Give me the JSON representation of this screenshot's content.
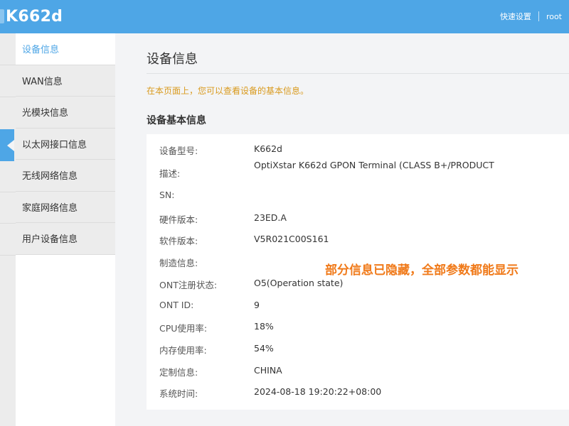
{
  "header": {
    "title": "K662d",
    "quick_setup": "快速设置",
    "user": "root"
  },
  "sidebar": {
    "items": [
      {
        "label": "设备信息",
        "active": true
      },
      {
        "label": "WAN信息",
        "active": false
      },
      {
        "label": "光模块信息",
        "active": false
      },
      {
        "label": "以太网接口信息",
        "active": false
      },
      {
        "label": "无线网络信息",
        "active": false
      },
      {
        "label": "家庭网络信息",
        "active": false
      },
      {
        "label": "用户设备信息",
        "active": false
      }
    ]
  },
  "main": {
    "page_title": "设备信息",
    "hint": "在本页面上，您可以查看设备的基本信息。",
    "section_title": "设备基本信息",
    "overlay_note": "部分信息已隐藏，全部参数都能显示",
    "fields": [
      {
        "label": "设备型号:",
        "value": "K662d"
      },
      {
        "label": "描述:",
        "value": "OptiXstar K662d GPON Terminal (CLASS B+/PRODUCT"
      },
      {
        "label": "SN:",
        "value": ""
      },
      {
        "label": "硬件版本:",
        "value": "23ED.A"
      },
      {
        "label": "软件版本:",
        "value": "V5R021C00S161"
      },
      {
        "label": "制造信息:",
        "value": ""
      },
      {
        "label": "ONT注册状态:",
        "value": "O5(Operation state)"
      },
      {
        "label": "ONT ID:",
        "value": "9"
      },
      {
        "label": "CPU使用率:",
        "value": "18%"
      },
      {
        "label": "内存使用率:",
        "value": "54%"
      },
      {
        "label": "定制信息:",
        "value": "CHINA"
      },
      {
        "label": "系统时间:",
        "value": "2024-08-18 19:20:22+08:00"
      }
    ]
  },
  "colors": {
    "accent": "#4ea6e6",
    "hint": "#d99a1e",
    "note": "#f07a1a"
  }
}
